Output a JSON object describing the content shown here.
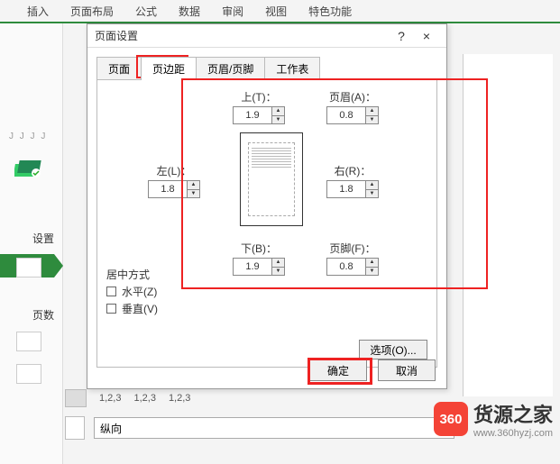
{
  "menu": {
    "items": [
      "插入",
      "页面布局",
      "公式",
      "数据",
      "审阅",
      "视图",
      "特色功能"
    ]
  },
  "sidebar": {
    "settings_label": "设置",
    "pages_label": "页数"
  },
  "dialog": {
    "title": "页面设置",
    "help": "?",
    "close": "×",
    "tabs": [
      "页面",
      "页边距",
      "页眉/页脚",
      "工作表"
    ],
    "margins": {
      "top": {
        "label": "上(T)：",
        "value": "1.9"
      },
      "header": {
        "label": "页眉(A)：",
        "value": "0.8"
      },
      "left": {
        "label": "左(L)：",
        "value": "1.8"
      },
      "right": {
        "label": "右(R)：",
        "value": "1.8"
      },
      "bottom": {
        "label": "下(B)：",
        "value": "1.9"
      },
      "footer": {
        "label": "页脚(F)：",
        "value": "0.8"
      }
    },
    "center": {
      "title": "居中方式",
      "horizontal": "水平(Z)",
      "vertical": "垂直(V)"
    },
    "options_btn": "选项(O)...",
    "ok": "确定",
    "cancel": "取消"
  },
  "bottom": {
    "page_nums": "1,2,3",
    "orientation": "纵向",
    "dropdown_arrow": "▾"
  },
  "watermark": {
    "logo": "360",
    "brand": "货源之家",
    "url": "www.360hyzj.com"
  }
}
